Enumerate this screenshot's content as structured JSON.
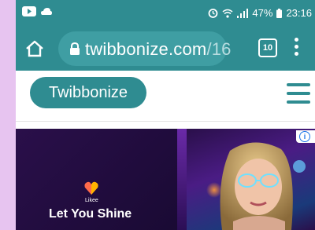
{
  "status_bar": {
    "battery_percent": "47%",
    "time": "23:16",
    "icons": [
      "youtube-icon",
      "cloud-icon",
      "alarm-icon",
      "wifi-icon",
      "signal-icon",
      "battery-icon"
    ]
  },
  "browser": {
    "url_domain": "twibbonize.com",
    "url_path": "/16",
    "tab_count": "10",
    "icons": [
      "home-icon",
      "lock-icon",
      "tabs-icon",
      "kebab-menu-icon"
    ]
  },
  "site": {
    "logo_label": "Twibbonize",
    "menu_icon": "hamburger-icon"
  },
  "ad": {
    "brand": "Likee",
    "headline": "Let You Shine",
    "info_icon": "info-icon"
  },
  "colors": {
    "accent": "#2f8c91",
    "page_background": "#e7c4f0",
    "ad_background": "#1d0c3a"
  }
}
